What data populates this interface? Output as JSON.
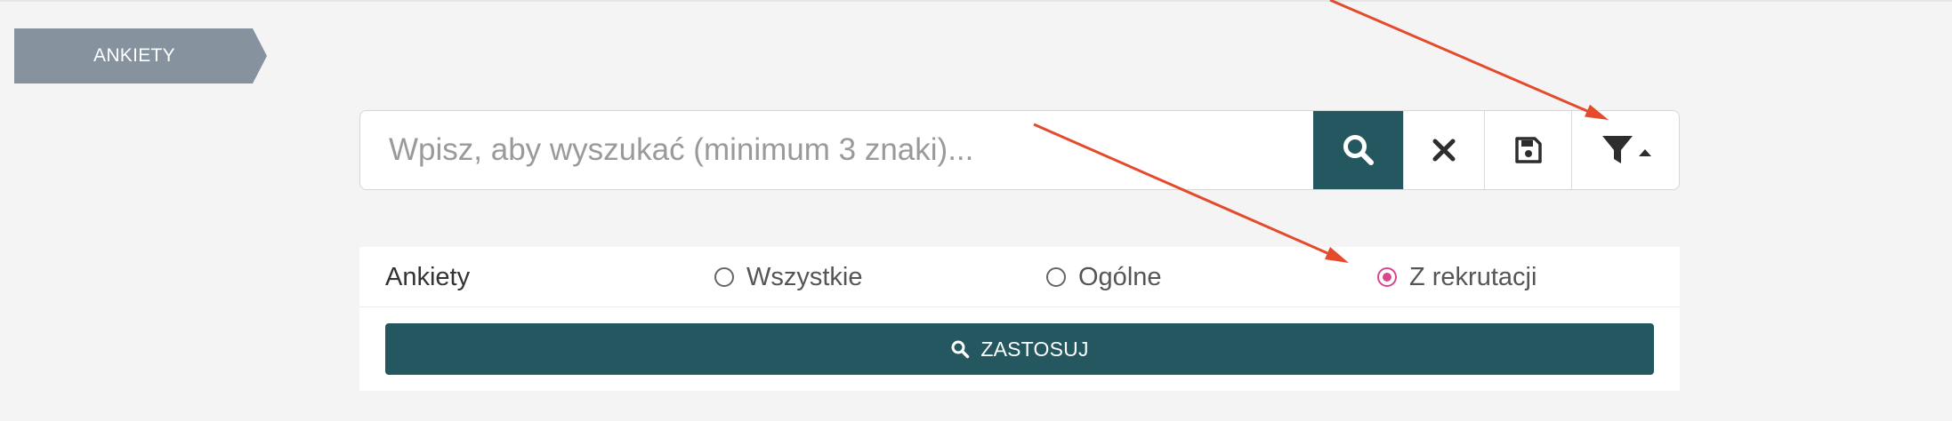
{
  "breadcrumb": {
    "label": "ANKIETY"
  },
  "search": {
    "placeholder": "Wpisz, aby wyszukać (minimum 3 znaki)...",
    "value": "",
    "buttons": {
      "search": "search-icon",
      "clear": "close-icon",
      "save": "save-icon",
      "filter": "filter-icon"
    }
  },
  "filter": {
    "label": "Ankiety",
    "options": [
      {
        "label": "Wszystkie",
        "checked": false
      },
      {
        "label": "Ogólne",
        "checked": false
      },
      {
        "label": "Z rekrutacji",
        "checked": true
      }
    ],
    "apply_label": "ZASTOSUJ"
  },
  "colors": {
    "primary": "#245760",
    "breadcrumb": "#86939e",
    "radio_checked": "#d9478a",
    "annotation_arrow": "#e54a2c"
  }
}
